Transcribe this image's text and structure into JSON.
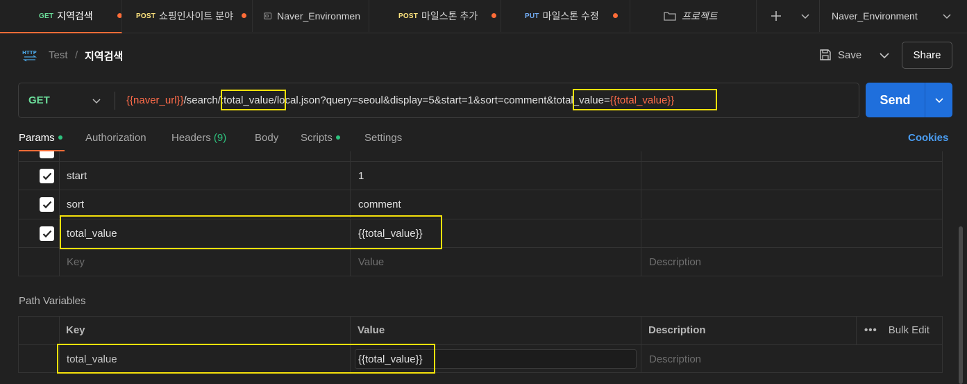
{
  "tabs": [
    {
      "method": "GET",
      "method_class": "m-get",
      "label": "지역검색",
      "dirty": true,
      "active": true
    },
    {
      "method": "POST",
      "method_class": "m-post",
      "label": "쇼핑인사이트 분야",
      "dirty": true,
      "active": false
    },
    {
      "method": "",
      "label": "Naver_Environmen",
      "dirty": false,
      "active": false
    },
    {
      "method": "POST",
      "method_class": "m-post",
      "label": "마일스톤 추가",
      "dirty": true,
      "active": false
    },
    {
      "method": "PUT",
      "method_class": "m-put",
      "label": "마일스톤 수정",
      "dirty": true,
      "active": false
    },
    {
      "method": "",
      "label": "프로젝트",
      "dirty": false,
      "active": false
    }
  ],
  "environment": {
    "selected": "Naver_Environment"
  },
  "breadcrumb": {
    "parent": "Test",
    "separator": "/",
    "current": "지역검색"
  },
  "toolbar": {
    "save_label": "Save",
    "share_label": "Share"
  },
  "request": {
    "method": "GET",
    "url_parts": {
      "var1": "{{naver_url}}",
      "seg1": "/search",
      "seg2": "/:total_value",
      "seg3": "/local.json?query=seoul&display=5&start=1&sort=comment",
      "seg4": "&total_value=",
      "var2": "{{total_value}}"
    },
    "send_label": "Send"
  },
  "request_tabs": {
    "params": "Params",
    "authorization": "Authorization",
    "headers": "Headers",
    "headers_count": "(9)",
    "body": "Body",
    "scripts": "Scripts",
    "settings": "Settings",
    "cookies": "Cookies"
  },
  "params": {
    "rows": [
      {
        "key": "start",
        "value": "1",
        "checked": true
      },
      {
        "key": "sort",
        "value": "comment",
        "checked": true
      },
      {
        "key": "total_value",
        "value": "{{total_value}}",
        "checked": true
      }
    ],
    "placeholders": {
      "key": "Key",
      "value": "Value",
      "description": "Description"
    }
  },
  "path_variables": {
    "title": "Path Variables",
    "headers": {
      "key": "Key",
      "value": "Value",
      "description": "Description",
      "bulk_edit": "Bulk Edit",
      "more": "•••"
    },
    "rows": [
      {
        "key": "total_value",
        "value": "{{total_value}}",
        "description_placeholder": "Description"
      }
    ]
  },
  "colors": {
    "accent": "#ff6c37",
    "send": "#1f6fdc",
    "variable": "#ff6c4a",
    "highlight": "#f5e10b",
    "get": "#6bdd9a",
    "post": "#ffe47e",
    "put": "#74aef6"
  }
}
